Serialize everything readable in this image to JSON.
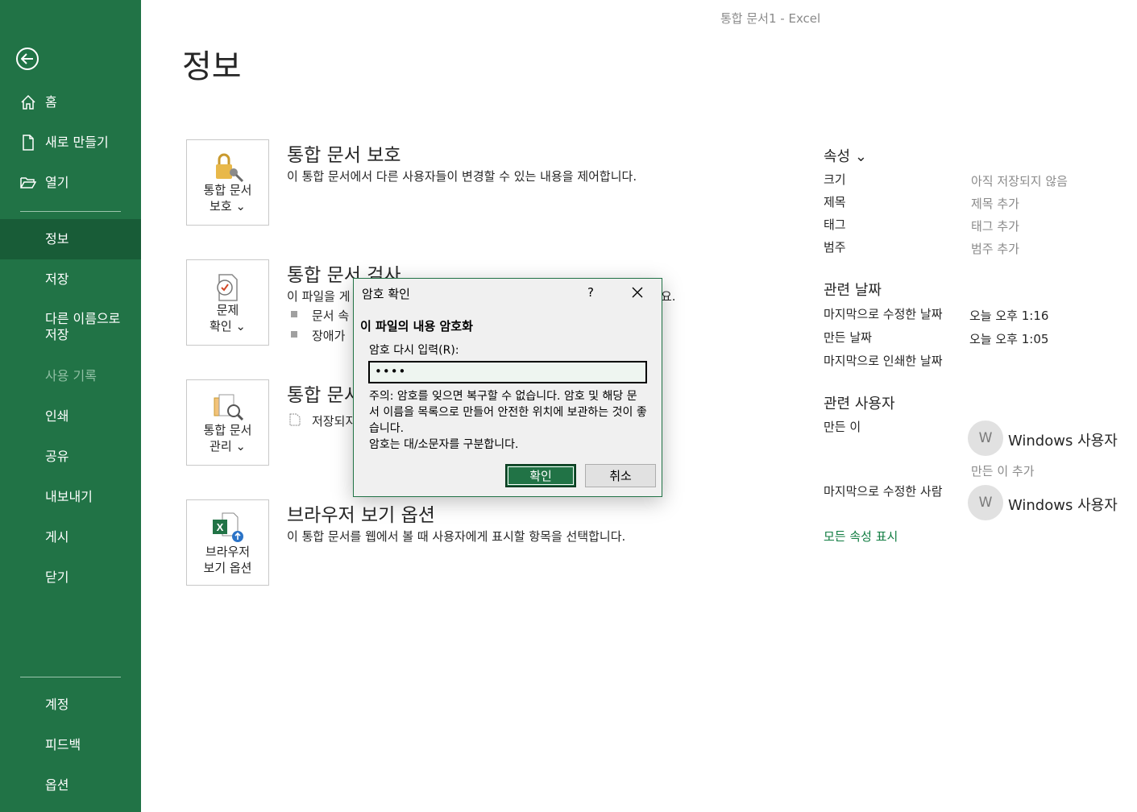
{
  "window": {
    "title": "통합 문서1  -  Excel"
  },
  "nav": {
    "items": [
      {
        "label": "홈",
        "icon": "home-icon"
      },
      {
        "label": "새로 만들기",
        "icon": "new-document-icon"
      },
      {
        "label": "열기",
        "icon": "folder-open-icon"
      },
      {
        "label": "정보",
        "state": "selected"
      },
      {
        "label": "저장"
      },
      {
        "label": "다른 이름으로\n저장"
      },
      {
        "label": "사용 기록",
        "state": "disabled"
      },
      {
        "label": "인쇄"
      },
      {
        "label": "공유"
      },
      {
        "label": "내보내기"
      },
      {
        "label": "게시"
      },
      {
        "label": "닫기"
      },
      {
        "label": "계정"
      },
      {
        "label": "피드백"
      },
      {
        "label": "옵션"
      }
    ]
  },
  "main": {
    "title": "정보",
    "sections": [
      {
        "tile_label": "통합 문서\n보호 ⌄",
        "title": "통합 문서 보호",
        "desc": "이 통합 문서에서 다른 사용자들이 변경할 수 있는 내용을 제어합니다."
      },
      {
        "tile_label": "문제\n확인 ⌄",
        "title": "통합 문서 검사",
        "desc": "이 파일을 게",
        "desc_tail": "요.",
        "bullets": [
          "문서 속",
          "장애가"
        ]
      },
      {
        "tile_label": "통합 문서\n관리 ⌄",
        "title": "통합 문서",
        "sub": "저장되지"
      },
      {
        "tile_label": "브라우저\n보기 옵션",
        "title": "브라우저 보기 옵션",
        "desc": "이 통합 문서를 웹에서 볼 때 사용자에게 표시할 항목을 선택합니다."
      }
    ]
  },
  "properties": {
    "header": "속성 ⌄",
    "rows": [
      {
        "label": "크기",
        "value": "아직 저장되지 않음"
      },
      {
        "label": "제목",
        "value": "제목 추가"
      },
      {
        "label": "태그",
        "value": "태그 추가"
      },
      {
        "label": "범주",
        "value": "범주 추가"
      }
    ],
    "dates_header": "관련 날짜",
    "dates": [
      {
        "label": "마지막으로 수정한 날짜",
        "value": "오늘 오후 1:16"
      },
      {
        "label": "만든 날짜",
        "value": "오늘 오후 1:05"
      },
      {
        "label": "마지막으로 인쇄한 날짜",
        "value": ""
      }
    ],
    "people_header": "관련 사용자",
    "author_label": "만든 이",
    "author_name": "Windows 사용자",
    "avatar_initial": "W",
    "add_author": "만든 이 추가",
    "modified_by_label": "마지막으로 수정한 사람",
    "modified_by_name": "Windows 사용자",
    "show_all": "모든 속성 표시"
  },
  "dialog": {
    "title": "암호 확인",
    "help": "?",
    "heading": "이 파일의 내용 암호화",
    "field_label": "암호 다시 입력(R):",
    "field_value": "••••",
    "note": "주의: 암호를 잊으면 복구할 수 없습니다. 암호 및 해당 문서 이름을 목록으로 만들어 안전한 위치에 보관하는 것이 좋습니다.\n암호는 대/소문자를 구분합니다.",
    "ok": "확인",
    "cancel": "취소"
  },
  "colors": {
    "accent": "#217346",
    "accent_dark": "#185c37",
    "link": "#107c41"
  }
}
